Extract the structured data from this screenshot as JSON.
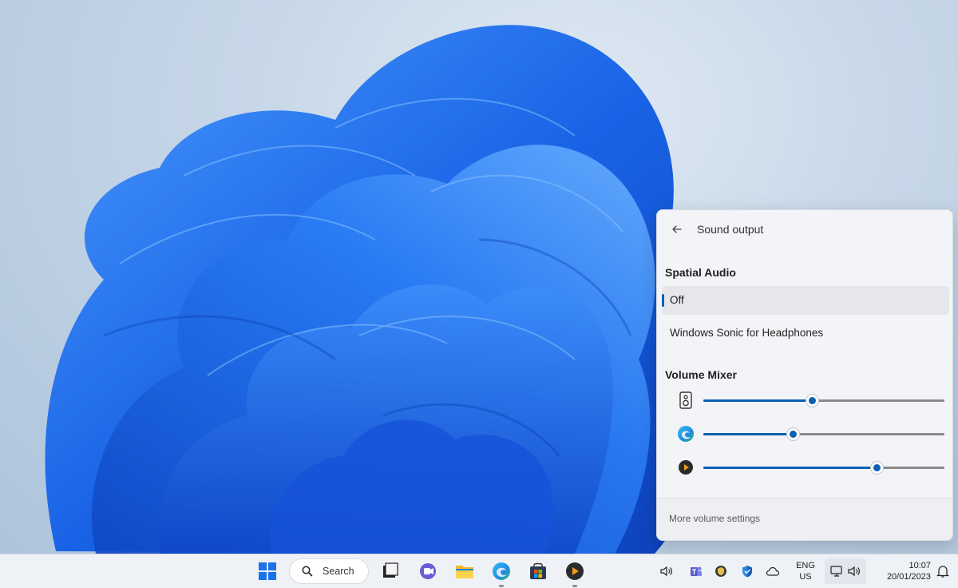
{
  "flyout": {
    "title": "Sound output",
    "spatial_audio": {
      "heading": "Spatial Audio",
      "options": [
        {
          "label": "Off",
          "selected": true
        },
        {
          "label": "Windows Sonic for Headphones",
          "selected": false
        }
      ]
    },
    "volume_mixer": {
      "heading": "Volume Mixer",
      "apps": [
        {
          "icon": "speaker-device-icon",
          "level": 0.45
        },
        {
          "icon": "edge-icon",
          "level": 0.37
        },
        {
          "icon": "media-player-icon",
          "level": 0.72
        }
      ]
    },
    "footer_link": "More volume settings"
  },
  "taskbar": {
    "search_label": "Search",
    "language": {
      "line1": "ENG",
      "line2": "US"
    },
    "clock": {
      "time": "10:07",
      "date": "20/01/2023"
    }
  },
  "colors": {
    "accent": "#0a5fb4",
    "wallpaper_bloom": "#1f6fe8"
  }
}
